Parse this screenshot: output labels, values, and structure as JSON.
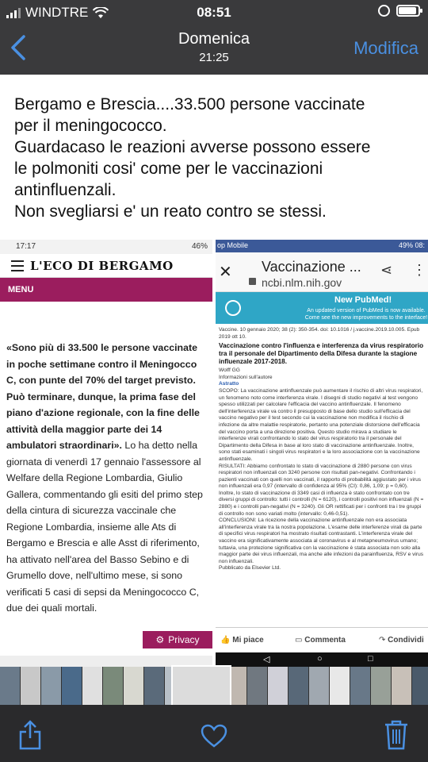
{
  "status_bar": {
    "carrier": "WINDTRE",
    "time": "08:51"
  },
  "nav": {
    "title": "Domenica",
    "subtitle": "21:25",
    "edit_label": "Modifica",
    "accent_color": "#4a90e2"
  },
  "post": {
    "text": "Bergamo e Brescia....33.500 persone vaccinate\nper il meningococco.\nGuardacaso le reazioni avverse possono essere\nle polmoniti cosi' come per le vaccinazioni\nantinfluenzali.\nNon svegliarsi e' un reato contro se stessi."
  },
  "left_screenshot": {
    "status_time": "17:17",
    "status_right": "46%",
    "logo": "L'ECO DI BERGAMO",
    "menu_label": "MENU",
    "brand_color": "#9b1d5e",
    "quote": "«Sono più di 33.500 le persone vaccinate in poche settimane contro il Meningocco C, con punte del 70% del target previsto. Può terminare, dunque, la prima fase del piano d'azione regionale, con la fine delle attività della maggior parte dei 14 ambulatori straordinari».",
    "body": " Lo ha detto nella giornata di venerdì 17 gennaio l'assessore al Welfare della Regione Lombardia, Giulio Gallera, commentando gli esiti del primo step della cintura di sicurezza vaccinale che Regione Lombardia, insieme alle Ats di Bergamo e Brescia e alle Asst di riferimento, ha attivato nell'area del Basso Sebino e di Grumello dove, nell'ultimo mese, si sono verificati 5 casi di sepsi da Meningococco C, due dei quali mortali.",
    "privacy_label": "Privacy"
  },
  "right_screenshot": {
    "status_left": "op Mobile",
    "status_right": "49%  08:",
    "title": "Vaccinazione ...",
    "url": "ncbi.nlm.nih.gov",
    "banner_title": "New PubMed!",
    "banner_sub": "An updated version of PubMed is now available. Come see the new improvements to the interface!",
    "citation": "Vaccine. 10 gennaio 2020; 38 (2): 350-354. doi: 10.1016 / j.vaccine.2019.10.005. Epub 2019 ott 10.",
    "article_title": "Vaccinazione contro l'influenza e interferenza da virus respiratorio tra il personale del Dipartimento della Difesa durante la stagione influenzale 2017-2018.",
    "author": "Wolff GG",
    "author_info": "Informazioni sull'autore",
    "abstract_label": "Astratto",
    "abstract": "SCOPO: La vaccinazione antinfluenzale può aumentare il rischio di altri virus respiratori, un fenomeno noto come interferenza virale. I disegni di studio negativi al test vengono spesso utilizzati per calcolare l'efficacia del vaccino antinfluenzale. Il fenomeno dell'interferenza virale va contro il presupposto di base dello studio sull'efficacia del vaccino negativo per il test secondo cui la vaccinazione non modifica il rischio di infezione da altre malattie respiratorie, pertanto una potenziale distorsione dell'efficacia del vaccino porta a una direzione positiva. Questo studio mirava a studiare le interferenze virali confrontando lo stato del virus respiratorio tra il personale del Dipartimento della Difesa in base al loro stato di vaccinazione antinfluenzale. Inoltre, sono stati esaminati i singoli virus respiratori e la loro associazione con la vaccinazione antinfluenzale.",
    "results": "RISULTATI: Abbiamo confrontato lo stato di vaccinazione di 2880 persone con virus respiratori non influenzali con 3240 persone con risultati pan-negativi. Confrontando i pazienti vaccinati con quelli non vaccinati, il rapporto di probabilità aggiustato per i virus non influenzali era 0,97 (intervallo di confidenza al 95% (CI): 0,86, 1,09; p = 0,60). Inoltre, lo stato di vaccinazione di 3349 casi di influenza è stato confrontato con tre diversi gruppi di controllo: tutti i controlli (N = 6120), i controlli positivi non influenzali (N = 2880) e i controlli pan-negativi (N = 3240). Gli OR rettificati per i confronti tra i tre gruppi di controllo non sono variati molto (intervallo: 0,46-0,51).",
    "conclusions": "CONCLUSIONI: La ricezione della vaccinazione antinfluenzale non era associata all'interferenza virale tra la nostra popolazione. L'esame delle interferenze virali da parte di specifici virus respiratori ha mostrato risultati contrastanti. L'interferenza virale del vaccino era significativamente associata al coronavirus e al metapneumovirus umano; tuttavia, una protezione significativa con la vaccinazione è stata associata non solo alla maggior parte dei virus influenzali, ma anche alle infezioni da parainfluenza, RSV e virus non influenzali.",
    "publisher": "Pubblicato da Elsevier Ltd.",
    "like_label": "Mi piace",
    "comment_label": "Commenta",
    "share_label": "Condividi"
  },
  "thumbnails": {
    "colors": [
      "#6a7a8a",
      "#c8c8c8",
      "#8a9aa8",
      "#4a6a8a",
      "#e0e0e0",
      "#7a8a7a",
      "#d8d8d0",
      "#5a6a7a",
      "#b8c0c8",
      "#3a4a5a",
      "#909898",
      "#c0b8b0",
      "#707880",
      "#d0d0d8",
      "#586878",
      "#a0a8b0",
      "#e8e8e8",
      "#687888",
      "#98a098",
      "#c8c0b8",
      "#4a5a6a",
      "#b0b8c0",
      "#7a7a80",
      "#d8d0c8",
      "#606870",
      "#a8b0b8"
    ]
  },
  "toolbar": {
    "share_icon": "share-icon",
    "favorite_icon": "heart-icon",
    "delete_icon": "trash-icon"
  }
}
